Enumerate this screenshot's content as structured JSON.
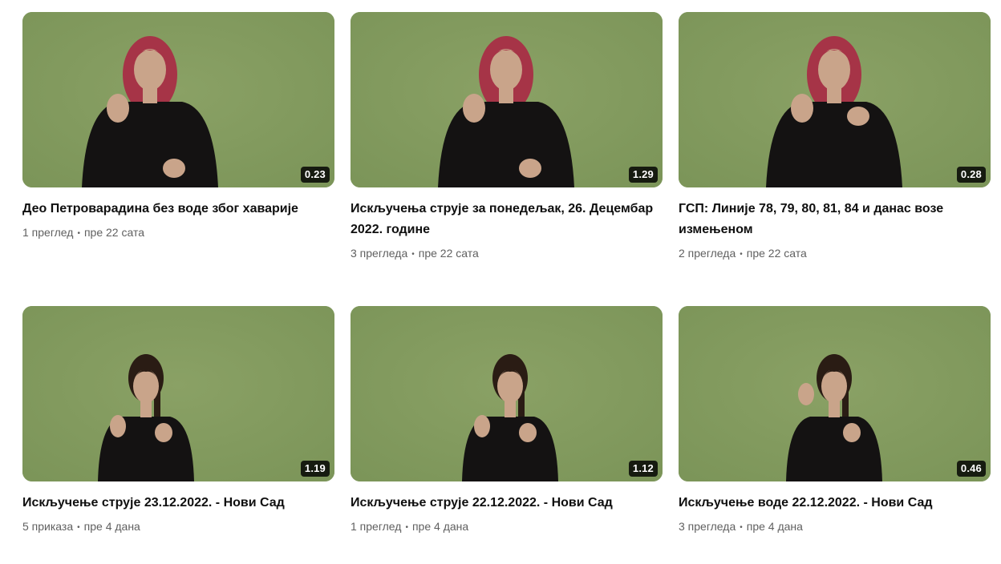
{
  "videos": [
    {
      "title": "Део Петроварадина без воде због хаварије",
      "duration": "0.23",
      "views": "1 преглед",
      "separator": "•",
      "age": "пре 22 сата",
      "presenter": "red-hair"
    },
    {
      "title": "Искључења струје за понедељак, 26. Децембар 2022. године",
      "duration": "1.29",
      "views": "3 прегледа",
      "separator": "•",
      "age": "пре 22 сата",
      "presenter": "red-hair"
    },
    {
      "title": "ГСП: Линије 78, 79, 80, 81, 84 и данас возе измењеном",
      "duration": "0.28",
      "views": "2 прегледа",
      "separator": "•",
      "age": "пре 22 сата",
      "presenter": "red-hair"
    },
    {
      "title": "Искључење струје 23.12.2022. - Нови Сад",
      "duration": "1.19",
      "views": "5 приказа",
      "separator": "•",
      "age": "пре 4 дана",
      "presenter": "dark-hair"
    },
    {
      "title": "Искључење струје 22.12.2022. - Нови Сад",
      "duration": "1.12",
      "views": "1 преглед",
      "separator": "•",
      "age": "пре 4 дана",
      "presenter": "dark-hair"
    },
    {
      "title": "Искључење воде 22.12.2022. - Нови Сад",
      "duration": "0.46",
      "views": "3 прегледа",
      "separator": "•",
      "age": "пре 4 дана",
      "presenter": "dark-hair"
    }
  ],
  "colors": {
    "thumbnail_background": "#7c9559",
    "duration_badge": "#000000",
    "title_text": "#0f0f0f",
    "meta_text": "#606060"
  }
}
